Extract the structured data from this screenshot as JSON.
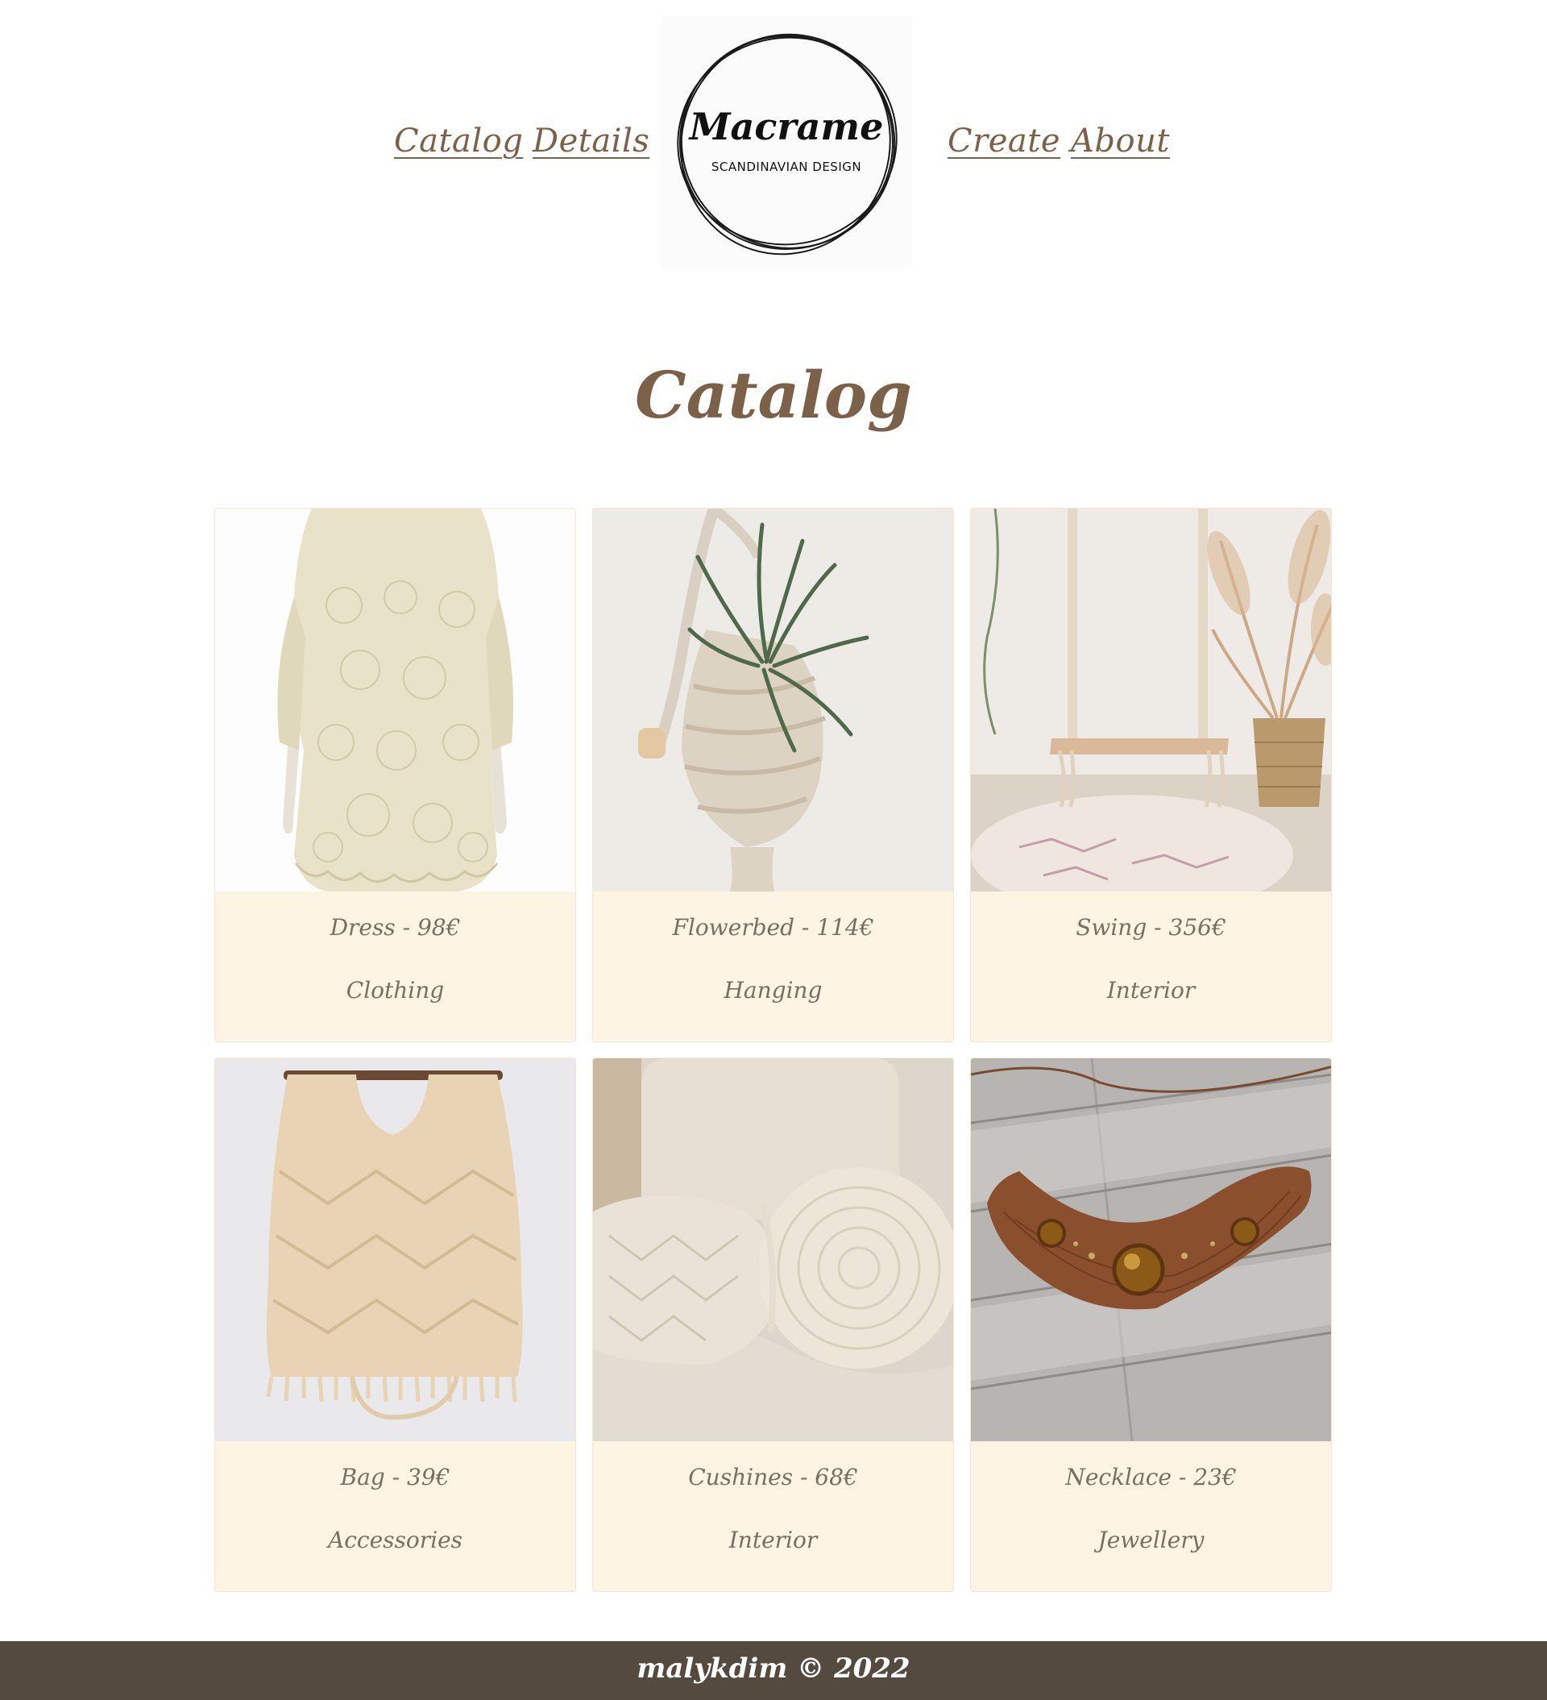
{
  "nav": {
    "links": [
      "Catalog",
      "Details",
      "Create",
      "About"
    ]
  },
  "logo": {
    "word": "Macrame",
    "subtitle": "SCANDINAVIAN DESIGN"
  },
  "page": {
    "title": "Catalog"
  },
  "catalog": {
    "items": [
      {
        "name": "Dress - 98€",
        "category": "Clothing",
        "icon": "dress-image"
      },
      {
        "name": "Flowerbed - 114€",
        "category": "Hanging",
        "icon": "flowerbed-image"
      },
      {
        "name": "Swing - 356€",
        "category": "Interior",
        "icon": "swing-image"
      },
      {
        "name": "Bag - 39€",
        "category": "Accessories",
        "icon": "bag-image"
      },
      {
        "name": "Cushines - 68€",
        "category": "Interior",
        "icon": "cushions-image"
      },
      {
        "name": "Necklace - 23€",
        "category": "Jewellery",
        "icon": "necklace-image"
      }
    ]
  },
  "footer": {
    "text": "malykdim © 2022"
  },
  "colors": {
    "accent": "#7a6148",
    "card_bg": "#fef4e3",
    "card_text": "#7a6e63",
    "footer_bg": "#554a3e"
  }
}
